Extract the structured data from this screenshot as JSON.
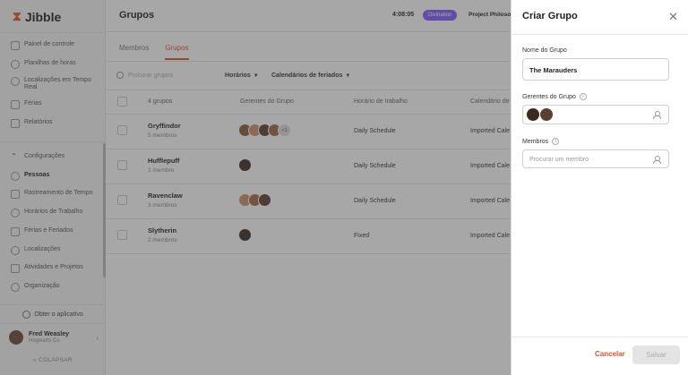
{
  "app": {
    "logo_text": "Jibble"
  },
  "sidebar": {
    "items": [
      {
        "label": "Painel de controle",
        "icon": "dashboard-icon"
      },
      {
        "label": "Planilhas de horas",
        "icon": "clock-icon"
      },
      {
        "label": "Localizações em Tempo Real",
        "icon": "location-icon"
      },
      {
        "label": "Férias",
        "icon": "suitcase-icon"
      },
      {
        "label": "Relatórios",
        "icon": "report-icon"
      }
    ],
    "section_label": "Configurações",
    "settings_items": [
      {
        "label": "Pessoas",
        "icon": "people-icon",
        "active": true
      },
      {
        "label": "Rastreamento de Tempo",
        "icon": "timer-icon"
      },
      {
        "label": "Horários de Trabalho",
        "icon": "schedule-icon"
      },
      {
        "label": "Férias e Feriados",
        "icon": "holiday-icon"
      },
      {
        "label": "Localizações",
        "icon": "pin-icon"
      },
      {
        "label": "Atividades e Projetos",
        "icon": "tag-icon"
      },
      {
        "label": "Organização",
        "icon": "gear-icon"
      }
    ],
    "get_app": "Obter o aplicativo",
    "user": {
      "name": "Fred Weasley",
      "org": "Hogwarts Co"
    },
    "collapse": "COLAPSAR"
  },
  "header": {
    "title": "Grupos",
    "timer": "4:08:05",
    "badge": "Divination",
    "project": "Project Philosop"
  },
  "tabs": [
    {
      "label": "Membros",
      "active": false
    },
    {
      "label": "Grupos",
      "active": true
    }
  ],
  "filters": {
    "search_placeholder": "Procurar grupos",
    "schedules": "Horários",
    "holidays": "Calendários de feriados"
  },
  "table": {
    "count_label": "4 grupos",
    "columns": [
      "Gerentes do Grupo",
      "Horário de trabalho",
      "Calendário de"
    ],
    "rows": [
      {
        "name": "Gryffindor",
        "members": "5 membros",
        "schedule": "Daily Schedule",
        "calendar": "Imported Cale",
        "more": "+1"
      },
      {
        "name": "Hufflepuff",
        "members": "1 membro",
        "schedule": "Daily Schedule",
        "calendar": "Imported Cale"
      },
      {
        "name": "Ravenclaw",
        "members": "3 membros",
        "schedule": "Daily Schedule",
        "calendar": "Imported Cale"
      },
      {
        "name": "Slytherin",
        "members": "2 membros",
        "schedule": "Fixed",
        "calendar": "Imported Cale"
      }
    ]
  },
  "panel": {
    "title": "Criar Grupo",
    "group_name_label": "Nome do Grupo",
    "group_name_value": "The Marauders",
    "managers_label": "Gerentes do Grupo",
    "members_label": "Membros",
    "members_placeholder": "Procurar um membro",
    "cancel": "Cancelar",
    "save": "Salvar"
  },
  "colors": {
    "accent": "#e8532b",
    "badge": "#7c5cff"
  }
}
